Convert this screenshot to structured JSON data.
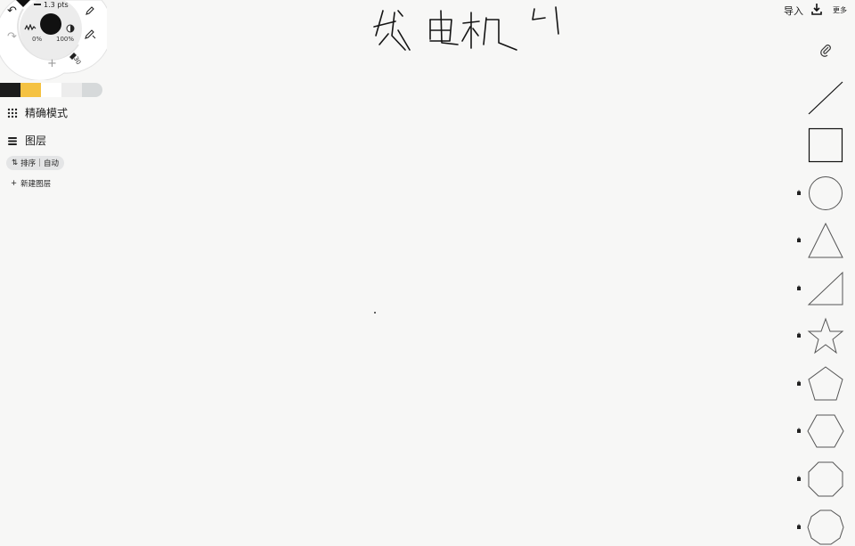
{
  "wheel": {
    "brush_size": "1.3 pts",
    "opacity_min": "0%",
    "opacity_max": "100%",
    "size_small": "30"
  },
  "palette": [
    "#1c1c1c",
    "#f5c242",
    "#ffffff",
    "#ececec",
    "#d6d9da"
  ],
  "sidebar": {
    "precision_mode": "精确模式",
    "layers": "图层",
    "sort_label": "排序",
    "sort_value": "自动",
    "new_layer": "新建图层"
  },
  "toolbar": {
    "import": "导入",
    "more": "更多"
  },
  "shapes": [
    "line",
    "square",
    "circle",
    "triangle",
    "right-triangle",
    "star",
    "pentagon",
    "hexagon",
    "octagon",
    "decagon"
  ],
  "handwriting": "发电机 4"
}
